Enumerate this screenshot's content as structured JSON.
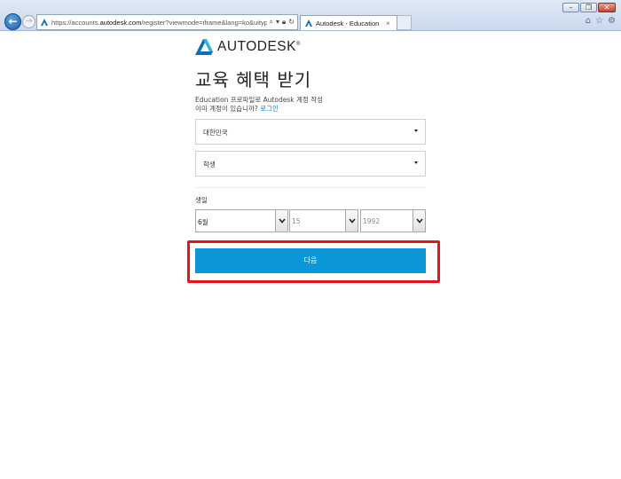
{
  "browser": {
    "url_host": "https://accounts.",
    "url_domain": "autodesk.com",
    "url_path": "/register?viewmode=iframe&lang=ko&uitype=educa",
    "tab_title": "Autodesk - Education",
    "tab_close": "×"
  },
  "page": {
    "logo_text": "AUTODESK",
    "logo_mark": "®",
    "title": "교육 혜택 받기",
    "subtitle": "Education 프로파일로 Autodesk 계정 작성",
    "have_account_text": "이미 계정이 있습니까?",
    "login_link": "로그인",
    "country_value": "대한민국",
    "role_value": "학생",
    "dob_label": "생일",
    "dob_month": "6월",
    "dob_day": "15",
    "dob_year": "1992",
    "next_button": "다음"
  },
  "colors": {
    "accent": "#0a96d7",
    "highlight": "#e8141a",
    "link": "#0a84c9"
  }
}
